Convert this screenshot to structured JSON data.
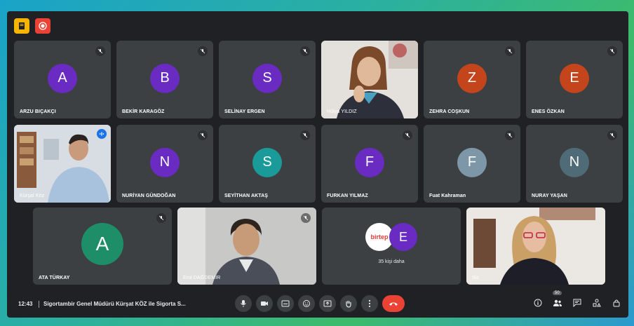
{
  "colors": {
    "avatar_purple": "#6a2bc2",
    "avatar_red": "#c4441c",
    "avatar_teal": "#1b9a9a",
    "avatar_gray": "#7d97a8",
    "avatar_slate": "#4f6b78",
    "avatar_green": "#1e8e68",
    "end_call": "#ea4335",
    "accent": "#8ab4f8"
  },
  "participants": {
    "p1": {
      "initial": "A",
      "name": "ARZU BIÇAKÇI"
    },
    "p2": {
      "initial": "B",
      "name": "BEKİR KARAGÖZ"
    },
    "p3": {
      "initial": "S",
      "name": "SELİNAY ERGEN"
    },
    "p4": {
      "name": "Hülya YILDIZ"
    },
    "p5": {
      "initial": "Z",
      "name": "ZEHRA COŞKUN"
    },
    "p6": {
      "initial": "E",
      "name": "ENES ÖZKAN"
    },
    "p7": {
      "name": "Kürşat Köz"
    },
    "p8": {
      "initial": "N",
      "name": "NURİYAN GÜNDOĞAN"
    },
    "p9": {
      "initial": "S",
      "name": "SEYİTHAN AKTAŞ"
    },
    "p10": {
      "initial": "F",
      "name": "FURKAN YILMAZ"
    },
    "p11": {
      "initial": "F",
      "name": "Fuat Kahraman"
    },
    "p12": {
      "initial": "N",
      "name": "NURAY YAŞAN"
    },
    "p13": {
      "initial": "A",
      "name": "ATA TÜRKAY"
    },
    "p14": {
      "name": "Erol DAĞDEMİR"
    },
    "p15": {
      "name": "Siz"
    }
  },
  "more_tile": {
    "logo_text": "birtep",
    "initial": "E",
    "label": "35 kişi daha"
  },
  "bottom": {
    "time": "12:43",
    "meeting_title": "Sigortambir Genel Müdürü Kürşat KÖZ ile Sigorta S...",
    "people_count": "50"
  }
}
